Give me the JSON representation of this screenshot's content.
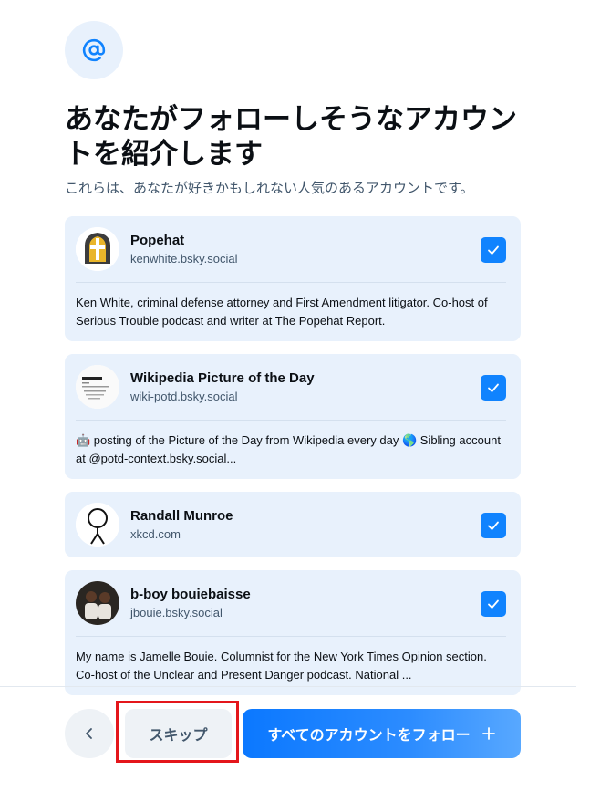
{
  "header": {
    "icon": "at-sign-icon",
    "title": "あなたがフォローしそうなアカウントを紹介します",
    "subtitle": "これらは、あなたが好きかもしれない人気のあるアカウントです。"
  },
  "accounts": [
    {
      "name": "Popehat",
      "handle": "kenwhite.bsky.social",
      "bio": "Ken White, criminal defense attorney and First Amendment litigator.  Co-host of Serious Trouble podcast and writer at The Popehat Report.",
      "checked": true
    },
    {
      "name": "Wikipedia Picture of the Day",
      "handle": "wiki-potd.bsky.social",
      "bio": "🤖 posting of the Picture of the Day from Wikipedia every day 🌎 Sibling account at @potd-context.bsky.social...",
      "checked": true
    },
    {
      "name": "Randall Munroe",
      "handle": "xkcd.com",
      "bio": "",
      "checked": true
    },
    {
      "name": "b-boy bouiebaisse",
      "handle": "jbouie.bsky.social",
      "bio": "My name is Jamelle Bouie. Columnist for the New York Times Opinion section. Co-host of the Unclear and Present Danger podcast. National ...",
      "checked": true
    }
  ],
  "footer": {
    "back_icon": "chevron-left-icon",
    "skip_label": "スキップ",
    "follow_all_label": "すべてのアカウントをフォロー",
    "follow_all_icon": "plus-icon"
  },
  "colors": {
    "accent": "#1083fe",
    "card_bg": "#e8f1fc",
    "highlight_outline": "#e4161b"
  }
}
